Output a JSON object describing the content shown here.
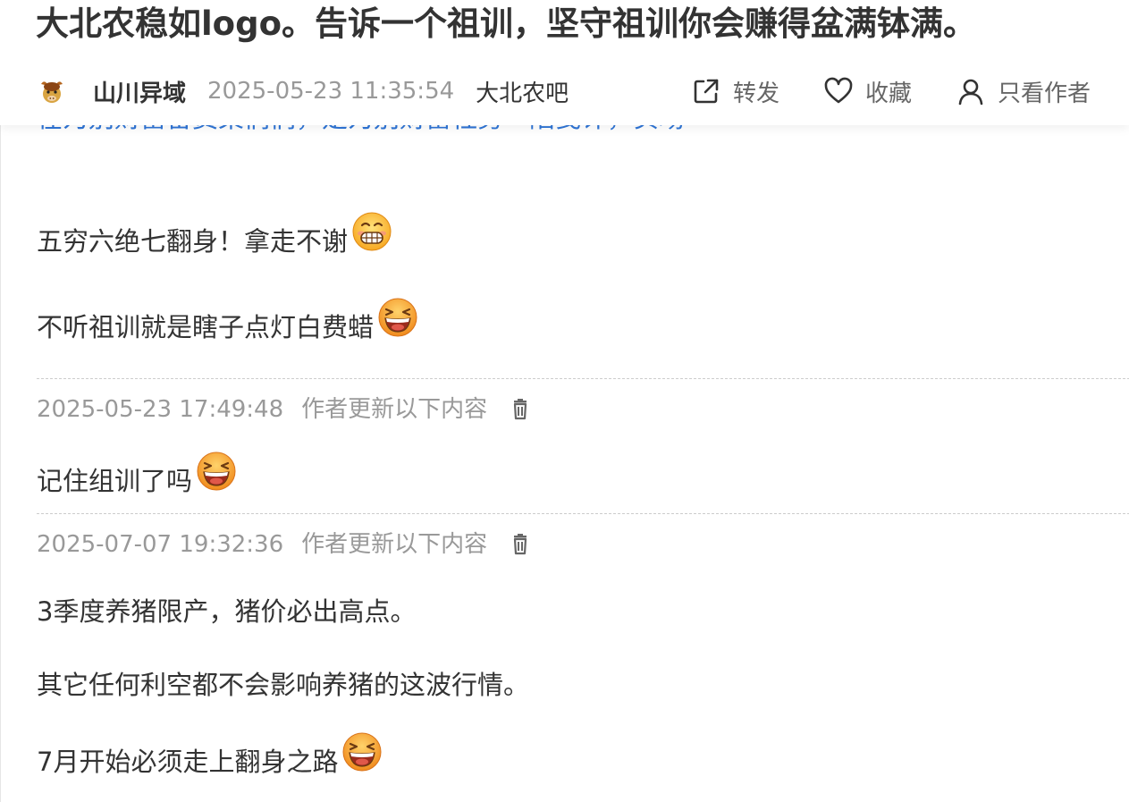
{
  "header": {
    "title": "大北农稳如logo。告诉一个祖训，坚守祖训你会赚得盆满钵满。",
    "author": "山川异域",
    "post_time": "2025-05-23 11:35:54",
    "bar_name": "大北农吧",
    "actions": {
      "share_label": "转发",
      "share_icon": "share-external-icon",
      "favorite_label": "收藏",
      "favorite_icon": "heart-icon",
      "only_author_label": "只看作者",
      "only_author_icon": "user-icon"
    }
  },
  "content": {
    "clipped_link_text": "在为别财富备费菜们们，是为别财富社务一陷曳许，实场",
    "paragraphs_initial": [
      {
        "text": "五穷六绝七翻身！拿走不谢",
        "emoji": "grinning-face-emoji"
      },
      {
        "text": "不听祖训就是瞎子点灯白费蜡",
        "emoji": "laughing-face-emoji"
      }
    ],
    "updates": [
      {
        "timestamp": "2025-05-23 17:49:48",
        "label": "作者更新以下内容",
        "delete_icon": "trash-icon",
        "paragraphs": [
          {
            "text": "记住组训了吗",
            "emoji": "laughing-face-emoji"
          }
        ]
      },
      {
        "timestamp": "2025-07-07 19:32:36",
        "label": "作者更新以下内容",
        "delete_icon": "trash-icon",
        "paragraphs": [
          {
            "text": "3季度养猪限产，猪价必出高点。"
          },
          {
            "text": "其它任何利空都不会影响养猪的这波行情。"
          },
          {
            "text": "7月开始必须走上翻身之路",
            "emoji": "laughing-face-emoji"
          }
        ]
      }
    ]
  },
  "colors": {
    "text_primary": "#333333",
    "text_muted": "#999999",
    "link": "#2f75d6",
    "divider": "#cccccc",
    "emoji_face": "#ffc83d",
    "emoji_mouth": "#9a2b1c"
  }
}
